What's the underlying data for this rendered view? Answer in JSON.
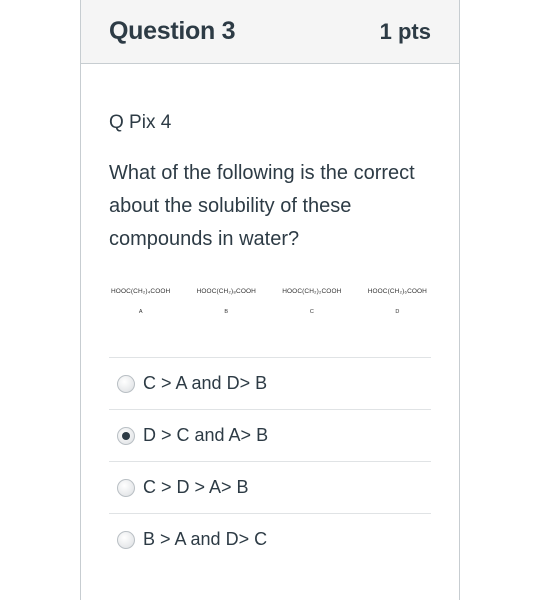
{
  "question": {
    "title": "Question 3",
    "points": "1 pts",
    "reference": "Q Pix 4",
    "text": "What of the following is the correct about the solubility of these compounds in water?"
  },
  "compounds": [
    {
      "formula": "HOOC(CH₂)₄COOH",
      "label": "A"
    },
    {
      "formula": "HOOC(CH₂)₈COOH",
      "label": "B"
    },
    {
      "formula": "HOOC(CH₂)₂COOH",
      "label": "C"
    },
    {
      "formula": "HOOC(CH₂)₆COOH",
      "label": "D"
    }
  ],
  "answers": [
    {
      "text": "C > A and D> B",
      "selected": false
    },
    {
      "text": "D > C and A> B",
      "selected": true
    },
    {
      "text": "C > D > A> B",
      "selected": false
    },
    {
      "text": "B > A and D> C",
      "selected": false
    }
  ]
}
